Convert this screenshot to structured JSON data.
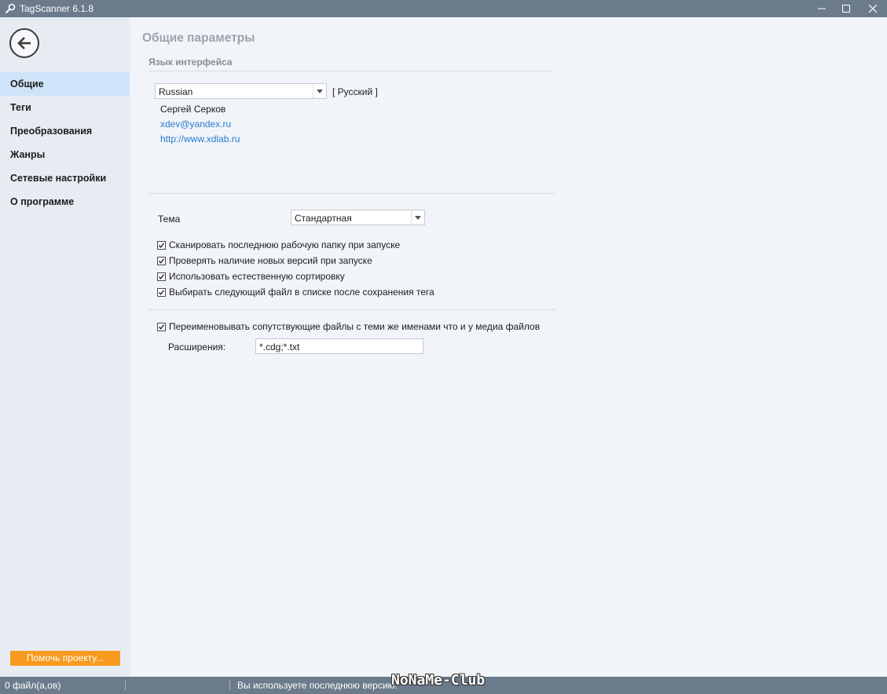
{
  "window": {
    "title": "TagScanner 6.1.8"
  },
  "sidebar": {
    "items": [
      {
        "label": "Общие",
        "active": true
      },
      {
        "label": "Теги"
      },
      {
        "label": "Преобразования"
      },
      {
        "label": "Жанры"
      },
      {
        "label": "Сетевые настройки"
      },
      {
        "label": "О программе"
      }
    ],
    "help_button": "Помочь проекту..."
  },
  "main": {
    "page_title": "Общие параметры",
    "language_section": "Язык интерфейса",
    "language": {
      "value": "Russian",
      "native": "[ Русский ]"
    },
    "author": {
      "name": "Сергей Серков",
      "email": "xdev@yandex.ru",
      "url": "http://www.xdlab.ru"
    },
    "theme": {
      "label": "Тема",
      "value": "Стандартная"
    },
    "checkboxes": [
      {
        "label": "Сканировать последнюю рабочую папку при запуске",
        "checked": true
      },
      {
        "label": "Проверять наличие новых версий при запуске",
        "checked": true
      },
      {
        "label": "Использовать естественную сортировку",
        "checked": true
      },
      {
        "label": "Выбирать следующий файл в списке после сохранения тега",
        "checked": true
      }
    ],
    "rename": {
      "label": "Переименовывать сопутствующие файлы с теми же именами что и у медиа файлов",
      "checked": true
    },
    "extensions": {
      "label": "Расширения:",
      "value": "*.cdg;*.txt"
    }
  },
  "status": {
    "files": "0 файл(а,ов)",
    "message": "Вы используете последнюю версию."
  },
  "watermark": "NoNaMe-Club"
}
